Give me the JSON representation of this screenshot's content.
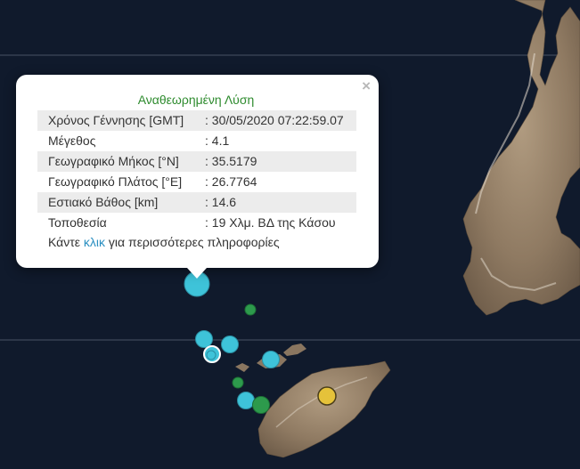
{
  "popup": {
    "title": "Αναθεωρημένη Λύση",
    "close_symbol": "×",
    "rows": [
      {
        "label": "Χρόνος Γέννησης [GMT]",
        "value": ": 30/05/2020 07:22:59.07"
      },
      {
        "label": "Μέγεθος",
        "value": ": 4.1"
      },
      {
        "label": "Γεωγραφικό Μήκος [°N]",
        "value": ": 35.5179"
      },
      {
        "label": "Γεωγραφικό Πλάτος [°E]",
        "value": ": 26.7764"
      },
      {
        "label": "Εστιακό Βάθος [km]",
        "value": ": 14.6"
      },
      {
        "label": "Τοποθεσία",
        "value": ": 19 Χλμ. ΒΔ της Κάσου"
      }
    ],
    "more_prefix": "Κάντε ",
    "more_link": "κλικ",
    "more_suffix": " για περισσότερες πληροφορίες"
  },
  "colors": {
    "sea": "#101a2c",
    "land": "#9c8770",
    "cyan_marker": "#3ec3d9",
    "green_marker": "#2d9a4c",
    "yellow_marker": "#e5c23a",
    "title_green": "#2e8b2e",
    "link_blue": "#2a8fc1"
  }
}
